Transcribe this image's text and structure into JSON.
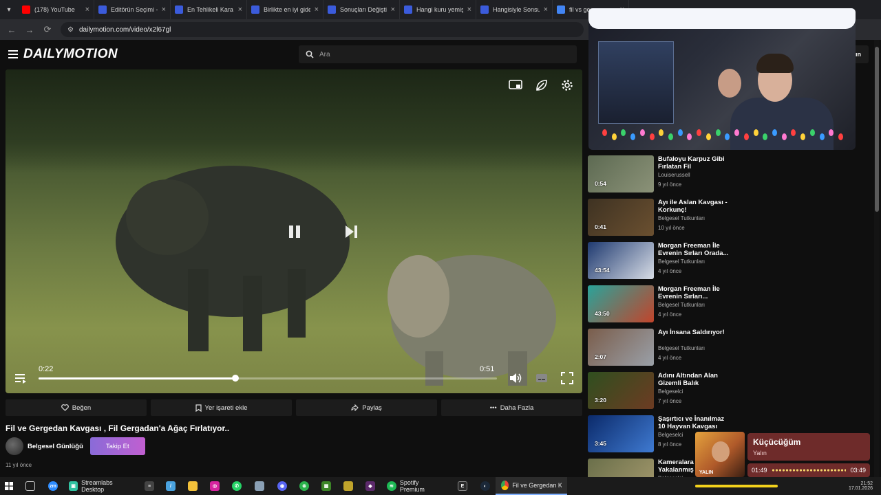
{
  "browser": {
    "tabs": [
      {
        "title": "(178) YouTube",
        "color": "#ff0000"
      },
      {
        "title": "Editörün Seçimi -",
        "color": "#3b5bdb"
      },
      {
        "title": "En Tehlikeli Kara",
        "color": "#3b5bdb"
      },
      {
        "title": "Birlikte en iyi gide",
        "color": "#3b5bdb"
      },
      {
        "title": "Sonuçları Değiştir",
        "color": "#3b5bdb"
      },
      {
        "title": "Hangi kuru yemiş",
        "color": "#3b5bdb"
      },
      {
        "title": "Hangisiyle Sonsuz",
        "color": "#3b5bdb"
      },
      {
        "title": "fil vs gerge",
        "color": "#4285f4"
      }
    ],
    "url": "dailymotion.com/video/x2l67gl"
  },
  "site": {
    "logo": "DAILYMOTION",
    "search_placeholder": "Ara",
    "signin_label": "ın"
  },
  "player": {
    "current_time": "0:22",
    "duration": "0:51",
    "progress": 0.43
  },
  "actions": {
    "like": "Beğen",
    "bookmark": "Yer işareti ekle",
    "share": "Paylaş",
    "more": "Daha Fazla"
  },
  "video": {
    "title": "Fil ve Gergedan Kavgası , Fil Gergadan'a Ağaç Fırlatıyor..",
    "channel": "Belgesel Günlüğü",
    "follow_label": "Takip Et",
    "posted": "11 yıl önce"
  },
  "recommendations": [
    {
      "title": "Bufaloyu Karpuz Gibi Fırlatan Fil",
      "channel": "Louiserussell",
      "ago": "9 yıl önce",
      "duration": "0:54",
      "thumb": [
        "#5d6a52",
        "#8b9278"
      ]
    },
    {
      "title": "Ayı ile Aslan Kavgası - Korkunç!",
      "channel": "Belgesel Tutkunları",
      "ago": "10 yıl önce",
      "duration": "0:41",
      "thumb": [
        "#3e3222",
        "#6b5030"
      ]
    },
    {
      "title": "Morgan Freeman İle Evrenin Sırları Orada...",
      "channel": "Belgesel Tutkunları",
      "ago": "4 yıl önce",
      "duration": "43:54",
      "thumb": [
        "#1f3a70",
        "#d8dde6"
      ]
    },
    {
      "title": "Morgan Freeman İle Evrenin Sırları...",
      "channel": "Belgesel Tutkunları",
      "ago": "4 yıl önce",
      "duration": "43:50",
      "thumb": [
        "#2aa39a",
        "#c2442b"
      ]
    },
    {
      "title": "Ayı İnsana Saldırıyor!",
      "channel": "Belgesel Tutkunları",
      "ago": "4 yıl önce",
      "duration": "2:07",
      "thumb": [
        "#7a5d4b",
        "#9aa0a8"
      ]
    },
    {
      "title": "Adını Altından Alan Gizemli Balık",
      "channel": "Belgeselci",
      "ago": "7 yıl önce",
      "duration": "3:20",
      "thumb": [
        "#2f4f1f",
        "#6d3b22"
      ]
    },
    {
      "title": "Şaşırtıcı ve İnanılmaz 10 Hayvan Kavgası",
      "channel": "Belgeselci",
      "ago": "8 yıl önce",
      "duration": "3:45",
      "thumb": [
        "#0b2a6a",
        "#3f7ad1"
      ]
    },
    {
      "title": "Kameralara Yakalanmış S",
      "channel": "Belgeselci",
      "ago": "",
      "duration": "",
      "thumb": [
        "#6a6f4a",
        "#a69a6e"
      ]
    }
  ],
  "music": {
    "title": "Küçücüğüm",
    "artist": "Yalın",
    "elapsed": "01:49",
    "total": "03:49",
    "art_label": "YALIN"
  },
  "taskbar": {
    "apps": [
      {
        "label": "Streamlabs Desktop"
      },
      {
        "label": "Spotify Premium"
      },
      {
        "label": "Fil ve Gergedan Kav..."
      }
    ],
    "time": "21:52",
    "date": "17.01.2026"
  }
}
